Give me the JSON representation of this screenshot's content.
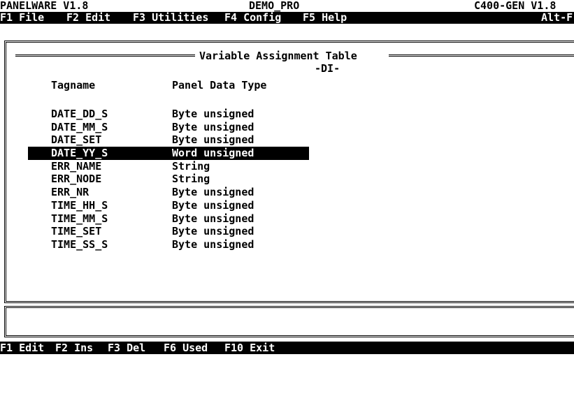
{
  "title_bar": {
    "app": "PANELWARE V1.8",
    "project": "DEMO_PRO",
    "target": "C400-GEN V1.8"
  },
  "menu": {
    "items": [
      {
        "label": "F1 File"
      },
      {
        "label": "F2 Edit"
      },
      {
        "label": "F3 Utilities"
      },
      {
        "label": "F4 Config"
      },
      {
        "label": "F5 Help"
      }
    ],
    "right_label": "Alt-F"
  },
  "panel": {
    "title": "Variable Assignment Table",
    "subtitle": "-DI-",
    "columns": {
      "tagname": "Tagname",
      "data_type": "Panel Data Type"
    },
    "rows": [
      {
        "tag": "DATE_DD_S",
        "type": "Byte unsigned"
      },
      {
        "tag": "DATE_MM_S",
        "type": "Byte unsigned"
      },
      {
        "tag": "DATE_SET",
        "type": "Byte unsigned"
      },
      {
        "tag": "DATE_YY_S",
        "type": "Word unsigned"
      },
      {
        "tag": "ERR_NAME",
        "type": "String"
      },
      {
        "tag": "ERR_NODE",
        "type": "String"
      },
      {
        "tag": "ERR_NR",
        "type": "Byte unsigned"
      },
      {
        "tag": "TIME_HH_S",
        "type": "Byte unsigned"
      },
      {
        "tag": "TIME_MM_S",
        "type": "Byte unsigned"
      },
      {
        "tag": "TIME_SET",
        "type": "Byte unsigned"
      },
      {
        "tag": "TIME_SS_S",
        "type": "Byte unsigned"
      }
    ],
    "selected_index": 3
  },
  "status_bar": {
    "keys": [
      {
        "label": "F1 Edit"
      },
      {
        "label": "F2 Ins"
      },
      {
        "label": "F3 Del"
      },
      {
        "label": "F6 Used"
      },
      {
        "label": "F10 Exit"
      }
    ]
  },
  "colors": {
    "background": "#ffffff",
    "foreground": "#000000",
    "highlight_bg": "#000000",
    "highlight_fg": "#ffffff"
  }
}
